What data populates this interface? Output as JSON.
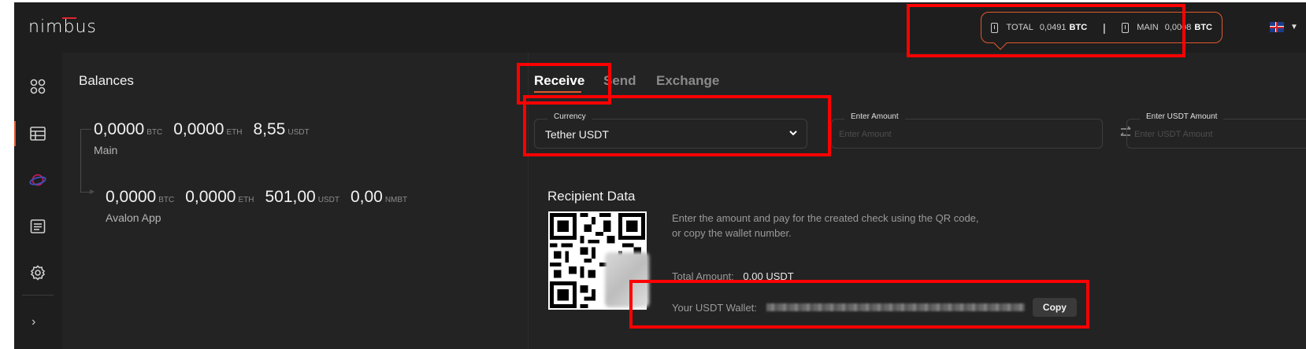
{
  "header": {
    "logo": "nimbus",
    "total_label": "TOTAL",
    "total_value": "0,0491",
    "total_currency": "BTC",
    "separator": "|",
    "main_label": "MAIN",
    "main_value": "0,0008",
    "main_currency": "BTC",
    "language_icon": "uk-flag-icon",
    "accent_color": "#e0592b"
  },
  "sidebar": {
    "items": [
      {
        "icon": "dashboard-icon"
      },
      {
        "icon": "table-icon",
        "active": true
      },
      {
        "icon": "planet-icon"
      },
      {
        "icon": "news-icon"
      },
      {
        "icon": "settings-icon"
      }
    ],
    "expand_icon": "chevron-right-icon",
    "expand_glyph": "›"
  },
  "balances": {
    "title": "Balances",
    "accounts": [
      {
        "name": "Main",
        "holdings": [
          {
            "amount": "0,0000",
            "currency": "BTC"
          },
          {
            "amount": "0,0000",
            "currency": "ETH"
          },
          {
            "amount": "8,55",
            "currency": "USDT"
          }
        ]
      },
      {
        "name": "Avalon App",
        "holdings": [
          {
            "amount": "0,0000",
            "currency": "BTC"
          },
          {
            "amount": "0,0000",
            "currency": "ETH"
          },
          {
            "amount": "501,00",
            "currency": "USDT"
          },
          {
            "amount": "0,00",
            "currency": "NMBT"
          }
        ]
      }
    ]
  },
  "tabs": [
    {
      "label": "Receive",
      "active": true
    },
    {
      "label": "Send",
      "active": false
    },
    {
      "label": "Exchange",
      "active": false
    }
  ],
  "form": {
    "currency_label": "Currency",
    "currency_value": "Tether USDT",
    "amount_label": "Enter Amount",
    "amount_placeholder": "Enter Amount",
    "usdt_label": "Enter USDT Amount",
    "usdt_placeholder": "Enter USDT Amount"
  },
  "recipient": {
    "title": "Recipient Data",
    "instructions_line1": "Enter the amount and pay for the created check using the QR code,",
    "instructions_line2": "or copy the wallet number.",
    "total_label": "Total Amount:",
    "total_value": "0,00 USDT",
    "wallet_label": "Your USDT Wallet:",
    "copy_label": "Copy"
  }
}
